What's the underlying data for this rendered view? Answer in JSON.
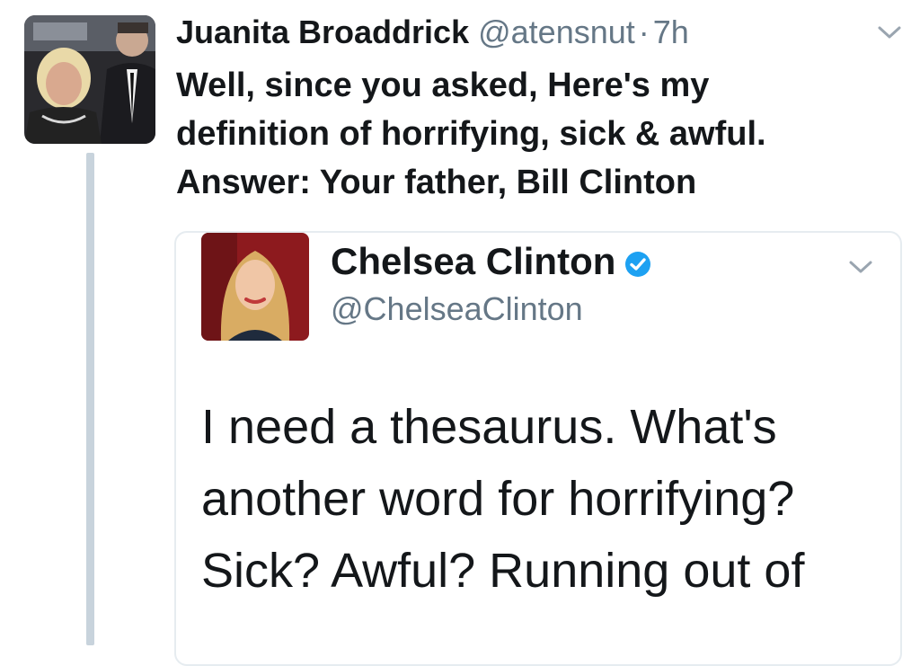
{
  "tweet": {
    "author_name": "Juanita Broaddrick",
    "author_handle": "@atensnut",
    "separator": "·",
    "time": "7h",
    "lines": [
      "Well, since you asked, Here's my",
      "definition of horrifying, sick & awful.",
      "Answer: Your father, Bill Clinton"
    ]
  },
  "quoted_tweet": {
    "author_name": "Chelsea Clinton",
    "author_handle": "@ChelseaClinton",
    "verified": true,
    "lines": [
      "I need a thesaurus. What's",
      "another word for horrifying?",
      "Sick? Awful? Running out of"
    ]
  },
  "icons": {
    "tweet_menu": "chevron-down-icon",
    "quote_menu": "chevron-down-icon",
    "verified": "verified-badge-icon"
  },
  "colors": {
    "text": "#14171a",
    "muted": "#657786",
    "verified_blue": "#1da1f2",
    "thread_line": "#c8d3dc",
    "border": "#e6ecf0"
  }
}
